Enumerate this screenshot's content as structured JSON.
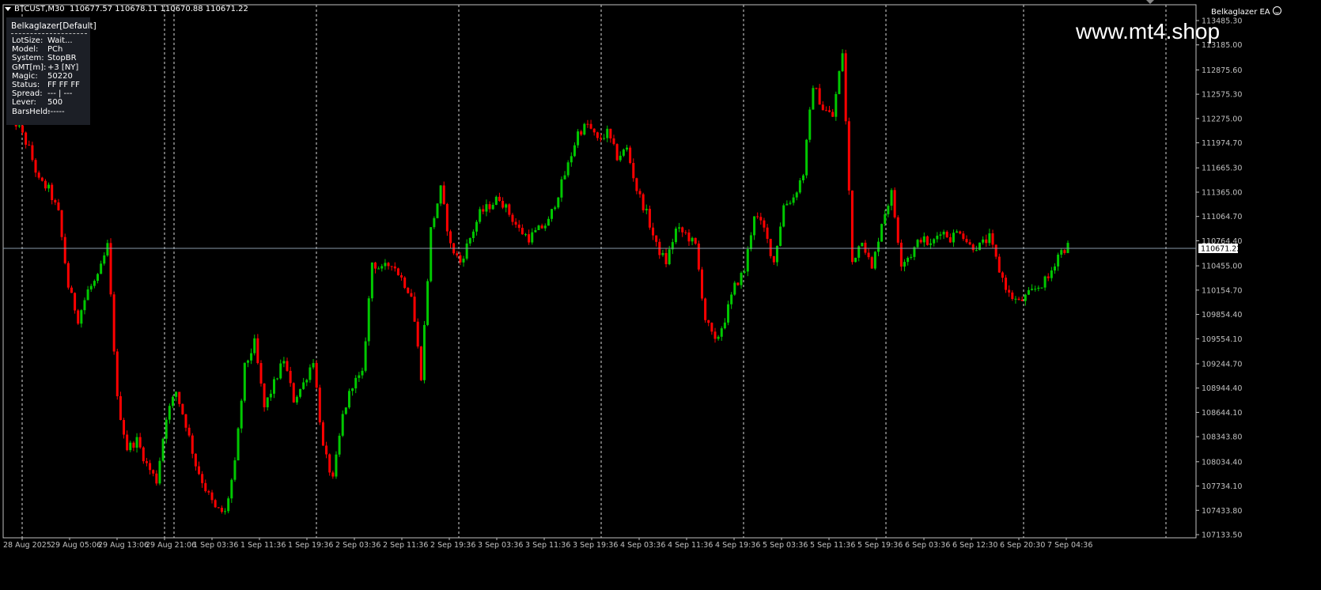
{
  "header": {
    "symbol": "BTCUST,M30",
    "ohlc": "110677.57 110678.11 110670.88 110671.22"
  },
  "ea": {
    "name": "Belkaglazer EA",
    "icon": "smiley-icon"
  },
  "watermark": "www.mt4.shop",
  "panel": {
    "title": "Belkaglazer[Default]",
    "rows": [
      {
        "key": "LotSize:",
        "value": "Wait..."
      },
      {
        "key": "Model:",
        "value": "PCh"
      },
      {
        "key": "System:",
        "value": "StopBR"
      },
      {
        "key": "GMT[m]:",
        "value": "+3 [NY]"
      },
      {
        "key": "Magic:",
        "value": "50220"
      },
      {
        "key": "Status:",
        "value": "FF FF FF"
      },
      {
        "key": "Spread:",
        "value": "--- | ---"
      },
      {
        "key": "Lever:",
        "value": "500"
      },
      {
        "key": "BarsHeld:",
        "value": "------"
      }
    ]
  },
  "colors": {
    "background": "#000000",
    "bull": "#00c800",
    "bear": "#ff0000",
    "grid": "#ffffff",
    "axis": "#c0c0c0",
    "bid_line": "#8a9aa8",
    "price_tag_bg": "#ffffff",
    "price_tag_text": "#000000"
  },
  "price_axis": {
    "labels": [
      "113485.30",
      "113185.00",
      "112875.60",
      "112575.30",
      "112275.00",
      "111974.70",
      "111665.30",
      "111365.00",
      "111064.70",
      "110764.40",
      "110455.00",
      "110154.70",
      "109854.40",
      "109554.10",
      "109244.70",
      "108944.40",
      "108644.10",
      "108343.80",
      "108034.40",
      "107734.10",
      "107433.80",
      "107133.50"
    ],
    "current_price": "110671.22"
  },
  "time_axis": {
    "labels": [
      "28 Aug 2025",
      "29 Aug 05:06",
      "29 Aug 13:06",
      "29 Aug 21:06",
      "1 Sep 03:36",
      "1 Sep 11:36",
      "1 Sep 19:36",
      "2 Sep 03:36",
      "2 Sep 11:36",
      "2 Sep 19:36",
      "3 Sep 03:36",
      "3 Sep 11:36",
      "3 Sep 19:36",
      "4 Sep 03:36",
      "4 Sep 11:36",
      "4 Sep 19:36",
      "5 Sep 03:36",
      "5 Sep 11:36",
      "5 Sep 19:36",
      "6 Sep 03:36",
      "6 Sep 12:30",
      "6 Sep 20:30",
      "7 Sep 04:36"
    ]
  },
  "chart_data": {
    "type": "candlestick",
    "symbol": "BTCUST",
    "timeframe": "M30",
    "ylim": [
      107133.5,
      113485.3
    ],
    "last_price": 110671.22,
    "grid": "vertical-dashed",
    "close_path": [
      [
        0,
        112350
      ],
      [
        3,
        112150
      ],
      [
        6,
        111900
      ],
      [
        9,
        111500
      ],
      [
        12,
        111400
      ],
      [
        15,
        111100
      ],
      [
        18,
        110200
      ],
      [
        21,
        109800
      ],
      [
        24,
        110150
      ],
      [
        27,
        110300
      ],
      [
        30,
        110700
      ],
      [
        33,
        108800
      ],
      [
        36,
        108200
      ],
      [
        39,
        108300
      ],
      [
        42,
        108000
      ],
      [
        45,
        107800
      ],
      [
        48,
        108600
      ],
      [
        51,
        108900
      ],
      [
        54,
        108500
      ],
      [
        57,
        108000
      ],
      [
        60,
        107700
      ],
      [
        63,
        107450
      ],
      [
        66,
        107400
      ],
      [
        69,
        108000
      ],
      [
        72,
        109200
      ],
      [
        75,
        109500
      ],
      [
        78,
        108700
      ],
      [
        81,
        109000
      ],
      [
        84,
        109300
      ],
      [
        87,
        108800
      ],
      [
        90,
        109000
      ],
      [
        93,
        109300
      ],
      [
        96,
        108200
      ],
      [
        99,
        107800
      ],
      [
        102,
        108600
      ],
      [
        105,
        109000
      ],
      [
        108,
        109100
      ],
      [
        111,
        110500
      ],
      [
        114,
        110400
      ],
      [
        117,
        110500
      ],
      [
        120,
        110300
      ],
      [
        123,
        110100
      ],
      [
        126,
        109100
      ],
      [
        129,
        110900
      ],
      [
        132,
        111400
      ],
      [
        135,
        110700
      ],
      [
        138,
        110500
      ],
      [
        141,
        110800
      ],
      [
        144,
        111100
      ],
      [
        147,
        111200
      ],
      [
        150,
        111300
      ],
      [
        153,
        111100
      ],
      [
        156,
        110900
      ],
      [
        159,
        110800
      ],
      [
        162,
        110900
      ],
      [
        165,
        111000
      ],
      [
        168,
        111350
      ],
      [
        171,
        111700
      ],
      [
        174,
        112100
      ],
      [
        177,
        112200
      ],
      [
        180,
        112000
      ],
      [
        183,
        112100
      ],
      [
        186,
        111800
      ],
      [
        189,
        111900
      ],
      [
        192,
        111400
      ],
      [
        195,
        111100
      ],
      [
        198,
        110700
      ],
      [
        201,
        110500
      ],
      [
        204,
        110900
      ],
      [
        207,
        110850
      ],
      [
        210,
        110700
      ],
      [
        213,
        109800
      ],
      [
        216,
        109500
      ],
      [
        219,
        109800
      ],
      [
        222,
        110200
      ],
      [
        225,
        110400
      ],
      [
        228,
        111100
      ],
      [
        231,
        110900
      ],
      [
        234,
        110500
      ],
      [
        237,
        111200
      ],
      [
        240,
        111300
      ],
      [
        243,
        111600
      ],
      [
        246,
        112700
      ],
      [
        249,
        112400
      ],
      [
        252,
        112300
      ],
      [
        255,
        113100
      ],
      [
        258,
        110500
      ],
      [
        261,
        110800
      ],
      [
        264,
        110400
      ],
      [
        267,
        111000
      ],
      [
        270,
        111350
      ],
      [
        273,
        110500
      ],
      [
        276,
        110600
      ],
      [
        279,
        110800
      ],
      [
        282,
        110700
      ],
      [
        285,
        110900
      ],
      [
        288,
        110800
      ],
      [
        291,
        110900
      ],
      [
        294,
        110700
      ],
      [
        297,
        110700
      ],
      [
        300,
        110800
      ],
      [
        303,
        110400
      ],
      [
        306,
        110100
      ],
      [
        309,
        110000
      ],
      [
        312,
        110100
      ],
      [
        315,
        110200
      ],
      [
        318,
        110300
      ],
      [
        321,
        110600
      ],
      [
        324,
        110700
      ]
    ]
  }
}
